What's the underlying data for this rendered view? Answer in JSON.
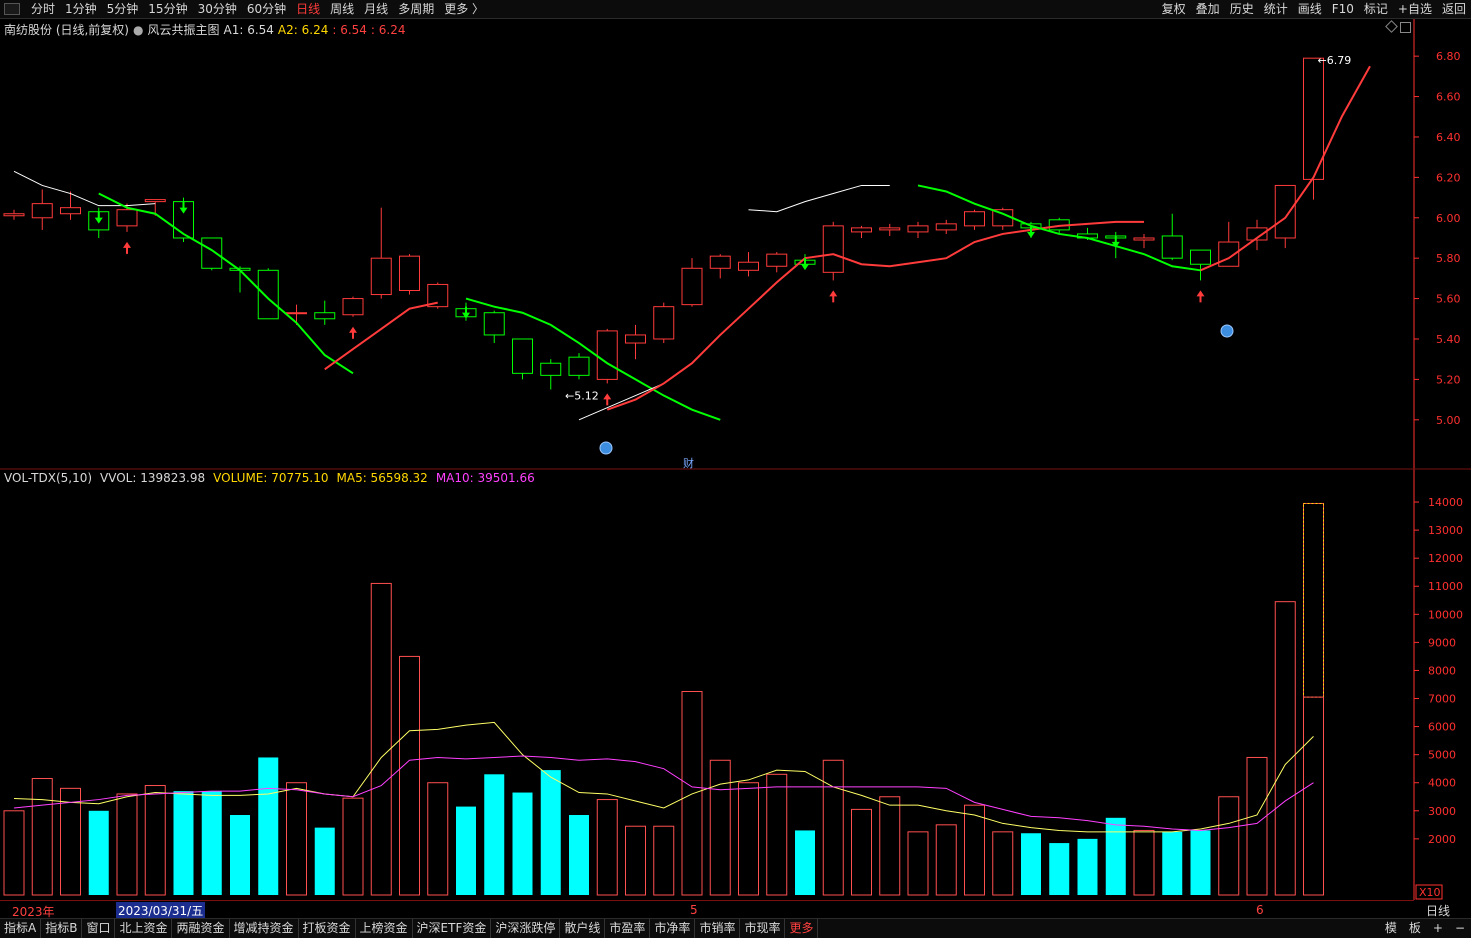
{
  "toolbar": {
    "tabs": [
      "分时",
      "1分钟",
      "5分钟",
      "15分钟",
      "30分钟",
      "60分钟",
      "日线",
      "周线",
      "月线",
      "多周期",
      "更多 〉"
    ],
    "active_tab": "日线",
    "tools": [
      "复权",
      "叠加",
      "历史",
      "统计",
      "画线",
      "F10",
      "标记",
      "+自选",
      "返回"
    ]
  },
  "info": {
    "stock": "南纺股份 (日线,前复权)",
    "indicator": "风云共振主图",
    "a1": "A1: 6.54",
    "a2": "A2: 6.24",
    "v3": ": 6.54",
    "v4": ": 6.24"
  },
  "volume_info": {
    "name": "VOL-TDX(5,10)",
    "vvol": "VVOL: 139823.98",
    "volume": "VOLUME: 70775.10",
    "ma5": "MA5: 56598.32",
    "ma10": "MA10: 39501.66"
  },
  "annotations": {
    "high": "6.79",
    "low": "←5.12",
    "cai": "财"
  },
  "date_axis": {
    "year": "2023年",
    "cursor_date": "2023/03/31/五",
    "m5": "5",
    "m6": "6",
    "period": "日线",
    "x10": "X10"
  },
  "bottom": {
    "tabs": [
      "指标A",
      "指标B",
      "窗口",
      "北上资金",
      "两融资金",
      "增减持资金",
      "打板资金",
      "上榜资金",
      "沪深ETF资金",
      "沪深涨跌停",
      "散户线",
      "市盈率",
      "市净率",
      "市销率",
      "市现率",
      "更多"
    ],
    "right": [
      "模",
      "板",
      "+",
      "−"
    ]
  },
  "colors": {
    "up": "#ff3b3b",
    "down": "#00ff00",
    "vol_down": "#00ffff",
    "ma5": "#ffff66",
    "ma10": "#ff40ff",
    "axis": "#ff3030",
    "white_line": "#ffffff"
  },
  "chart_data": {
    "type": "candlestick",
    "price_axis": {
      "range": [
        4.9,
        6.88
      ],
      "ticks": [
        "6.80",
        "6.60",
        "6.40",
        "6.20",
        "6.00",
        "5.80",
        "5.60",
        "5.40",
        "5.20",
        "5.00"
      ]
    },
    "volume_axis": {
      "range": [
        0,
        14500
      ],
      "ticks": [
        "14000",
        "13000",
        "12000",
        "11000",
        "10000",
        "9000",
        "8000",
        "7000",
        "6000",
        "5000",
        "4000",
        "3000",
        "2000"
      ]
    },
    "candles": [
      {
        "o": 6.01,
        "c": 6.02,
        "h": 6.04,
        "l": 5.99,
        "v": 3000
      },
      {
        "o": 6.0,
        "c": 6.07,
        "h": 6.14,
        "l": 5.94,
        "v": 4150
      },
      {
        "o": 6.02,
        "c": 6.05,
        "h": 6.13,
        "l": 5.99,
        "v": 3800
      },
      {
        "o": 6.03,
        "c": 5.94,
        "h": 6.05,
        "l": 5.9,
        "v": 3000
      },
      {
        "o": 5.96,
        "c": 6.04,
        "h": 6.07,
        "l": 5.93,
        "v": 3600
      },
      {
        "o": 6.08,
        "c": 6.09,
        "h": 6.09,
        "l": 6.01,
        "v": 3900
      },
      {
        "o": 6.08,
        "c": 5.9,
        "h": 6.1,
        "l": 5.88,
        "v": 3700
      },
      {
        "o": 5.9,
        "c": 5.75,
        "h": 5.9,
        "l": 5.74,
        "v": 3700
      },
      {
        "o": 5.75,
        "c": 5.74,
        "h": 5.76,
        "l": 5.63,
        "v": 2850
      },
      {
        "o": 5.74,
        "c": 5.5,
        "h": 5.75,
        "l": 5.5,
        "v": 4900
      },
      {
        "o": 5.53,
        "c": 5.53,
        "h": 5.57,
        "l": 5.47,
        "v": 4000
      },
      {
        "o": 5.53,
        "c": 5.5,
        "h": 5.59,
        "l": 5.47,
        "v": 2400
      },
      {
        "o": 5.52,
        "c": 5.6,
        "h": 5.61,
        "l": 5.51,
        "v": 3450
      },
      {
        "o": 5.62,
        "c": 5.8,
        "h": 6.05,
        "l": 5.6,
        "v": 11100
      },
      {
        "o": 5.64,
        "c": 5.81,
        "h": 5.82,
        "l": 5.62,
        "v": 8500
      },
      {
        "o": 5.56,
        "c": 5.67,
        "h": 5.68,
        "l": 5.55,
        "v": 4000
      },
      {
        "o": 5.55,
        "c": 5.51,
        "h": 5.58,
        "l": 5.49,
        "v": 3150
      },
      {
        "o": 5.53,
        "c": 5.42,
        "h": 5.54,
        "l": 5.38,
        "v": 4300
      },
      {
        "o": 5.4,
        "c": 5.23,
        "h": 5.4,
        "l": 5.2,
        "v": 3650
      },
      {
        "o": 5.28,
        "c": 5.22,
        "h": 5.3,
        "l": 5.15,
        "v": 4450
      },
      {
        "o": 5.31,
        "c": 5.22,
        "h": 5.33,
        "l": 5.2,
        "v": 2850
      },
      {
        "o": 5.2,
        "c": 5.44,
        "h": 5.45,
        "l": 5.18,
        "v": 3400
      },
      {
        "o": 5.38,
        "c": 5.42,
        "h": 5.47,
        "l": 5.3,
        "v": 2450
      },
      {
        "o": 5.4,
        "c": 5.56,
        "h": 5.58,
        "l": 5.38,
        "v": 2450
      },
      {
        "o": 5.57,
        "c": 5.75,
        "h": 5.8,
        "l": 5.56,
        "v": 7250
      },
      {
        "o": 5.75,
        "c": 5.81,
        "h": 5.82,
        "l": 5.7,
        "v": 4800
      },
      {
        "o": 5.74,
        "c": 5.78,
        "h": 5.83,
        "l": 5.71,
        "v": 4000
      },
      {
        "o": 5.76,
        "c": 5.82,
        "h": 5.83,
        "l": 5.73,
        "v": 4300
      },
      {
        "o": 5.79,
        "c": 5.77,
        "h": 5.82,
        "l": 5.75,
        "v": 2300
      },
      {
        "o": 5.73,
        "c": 5.96,
        "h": 5.98,
        "l": 5.69,
        "v": 4800
      },
      {
        "o": 5.93,
        "c": 5.95,
        "h": 5.96,
        "l": 5.9,
        "v": 3050
      },
      {
        "o": 5.94,
        "c": 5.95,
        "h": 5.97,
        "l": 5.91,
        "v": 3500
      },
      {
        "o": 5.93,
        "c": 5.96,
        "h": 5.98,
        "l": 5.9,
        "v": 2250
      },
      {
        "o": 5.94,
        "c": 5.97,
        "h": 5.99,
        "l": 5.92,
        "v": 2500
      },
      {
        "o": 5.96,
        "c": 6.03,
        "h": 6.04,
        "l": 5.94,
        "v": 3200
      },
      {
        "o": 5.96,
        "c": 6.04,
        "h": 6.05,
        "l": 5.94,
        "v": 2250
      },
      {
        "o": 5.97,
        "c": 5.95,
        "h": 5.98,
        "l": 5.9,
        "v": 2200
      },
      {
        "o": 5.99,
        "c": 5.94,
        "h": 6.0,
        "l": 5.92,
        "v": 1850
      },
      {
        "o": 5.92,
        "c": 5.9,
        "h": 5.95,
        "l": 5.89,
        "v": 2000
      },
      {
        "o": 5.91,
        "c": 5.9,
        "h": 5.93,
        "l": 5.8,
        "v": 2750
      },
      {
        "o": 5.89,
        "c": 5.9,
        "h": 5.92,
        "l": 5.85,
        "v": 2300
      },
      {
        "o": 5.91,
        "c": 5.8,
        "h": 6.02,
        "l": 5.79,
        "v": 2250
      },
      {
        "o": 5.84,
        "c": 5.77,
        "h": 5.84,
        "l": 5.69,
        "v": 2300
      },
      {
        "o": 5.76,
        "c": 5.88,
        "h": 5.98,
        "l": 5.76,
        "v": 3500
      },
      {
        "o": 5.89,
        "c": 5.95,
        "h": 5.99,
        "l": 5.84,
        "v": 4900
      },
      {
        "o": 5.9,
        "c": 6.16,
        "h": 6.16,
        "l": 5.85,
        "v": 10450
      },
      {
        "o": 6.19,
        "c": 6.79,
        "h": 6.79,
        "l": 6.09,
        "v": 13950
      }
    ],
    "vol_hollow_amount": 7050,
    "ma5": [
      3440,
      3400,
      3300,
      3250,
      3500,
      3650,
      3600,
      3550,
      3550,
      3600,
      3800,
      3600,
      3500,
      4900,
      5850,
      5900,
      6050,
      6150,
      5000,
      4200,
      3650,
      3600,
      3350,
      3100,
      3600,
      3950,
      4100,
      4450,
      4400,
      3850,
      3550,
      3200,
      3200,
      3000,
      2850,
      2550,
      2400,
      2300,
      2250,
      2250,
      2250,
      2250,
      2350,
      2550,
      2850,
      4650,
      5650
    ],
    "ma10": [
      3100,
      3200,
      3300,
      3400,
      3550,
      3600,
      3650,
      3700,
      3700,
      3800,
      3750,
      3600,
      3500,
      3900,
      4800,
      4900,
      4850,
      4900,
      4950,
      4900,
      4800,
      4850,
      4750,
      4500,
      3850,
      3750,
      3800,
      3850,
      3850,
      3850,
      3850,
      3850,
      3850,
      3800,
      3300,
      3050,
      2800,
      2750,
      2650,
      2500,
      2450,
      2350,
      2300,
      2400,
      2550,
      3350,
      4000
    ],
    "white_line": [
      6.23,
      6.16,
      6.12,
      6.06,
      6.06,
      6.07
    ],
    "white_line_2": [
      5.0,
      5.06,
      5.12,
      5.18
    ],
    "white_line_3": [
      6.04,
      6.03,
      6.08,
      6.12,
      6.16,
      6.16
    ],
    "red_line": [
      5.25,
      5.35,
      5.45,
      5.55,
      5.58
    ],
    "red_line_2": [
      5.05,
      5.1,
      5.18,
      5.28,
      5.42,
      5.55,
      5.68,
      5.8,
      5.82,
      5.77,
      5.76,
      5.78,
      5.8,
      5.88,
      5.92,
      5.94,
      5.96,
      5.97,
      5.98,
      5.98
    ],
    "green_line": [
      6.12,
      6.05,
      6.02,
      5.92,
      5.84,
      5.74,
      5.6,
      5.48,
      5.32,
      5.23
    ],
    "green_line_2": [
      5.6,
      5.56,
      5.53,
      5.47,
      5.38,
      5.28,
      5.2,
      5.12,
      5.05,
      5.0
    ],
    "green_line_3": [
      6.16,
      6.13,
      6.07,
      6.02,
      5.96,
      5.92,
      5.9,
      5.86,
      5.82,
      5.76,
      5.74
    ],
    "red_line_3": [
      5.74,
      5.8,
      5.9,
      6.0,
      6.2,
      6.5,
      6.75
    ],
    "up_arrows_idx": [
      4,
      12,
      21,
      29,
      42
    ],
    "down_arrows_idx": [
      3,
      6,
      16,
      28,
      36,
      39
    ]
  }
}
